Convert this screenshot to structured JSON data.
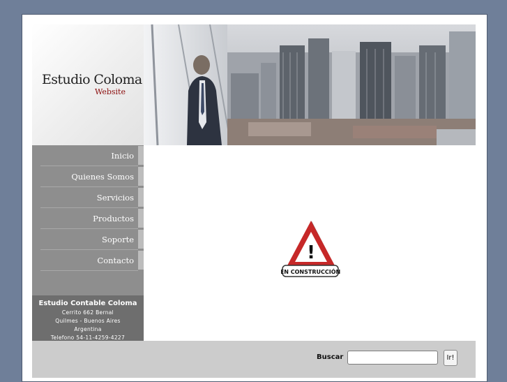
{
  "logo": {
    "title": "Estudio Coloma",
    "subtitle": "Website"
  },
  "menu": [
    {
      "label": "Inicio"
    },
    {
      "label": "Quienes Somos"
    },
    {
      "label": "Servicios"
    },
    {
      "label": "Productos"
    },
    {
      "label": "Soporte"
    },
    {
      "label": "Contacto"
    }
  ],
  "contact": {
    "name": "Estudio Contable Coloma",
    "lines": [
      "Cerrito 662 Bernal",
      "Quilmes - Buenos Aires",
      "Argentina",
      "Telefono 54-11-4259-4227"
    ]
  },
  "construction": {
    "sign_text": "EN CONSTRUCCIÓN",
    "symbol": "!"
  },
  "search": {
    "label": "Buscar",
    "value": "",
    "button_label": "Ir!"
  },
  "colors": {
    "background": "#6f7f99",
    "menu": "#8e8e8e",
    "contact_panel": "#6e6e6e",
    "accent": "#8b0d0d",
    "warning_red": "#c62828"
  }
}
